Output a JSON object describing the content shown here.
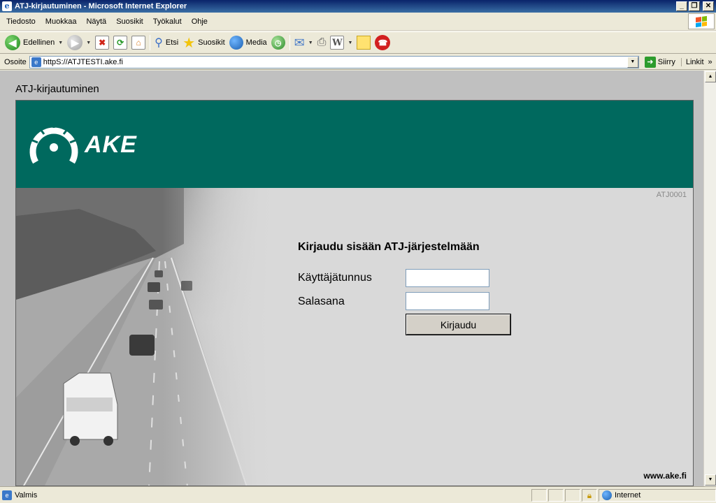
{
  "window": {
    "title": "ATJ-kirjautuminen - Microsoft Internet Explorer",
    "minimize": "_",
    "restore": "❐",
    "close": "✕"
  },
  "menu": {
    "items": [
      {
        "label": "Tiedosto"
      },
      {
        "label": "Muokkaa"
      },
      {
        "label": "Näytä"
      },
      {
        "label": "Suosikit"
      },
      {
        "label": "Työkalut"
      },
      {
        "label": "Ohje"
      }
    ]
  },
  "toolbar": {
    "back_label": "Edellinen",
    "search_label": "Etsi",
    "favorites_label": "Suosikit",
    "media_label": "Media"
  },
  "address": {
    "label": "Osoite",
    "url": "httpS://ATJTESTI.ake.fi",
    "go_label": "Siirry",
    "links_label": "Linkit",
    "links_chevron": "»"
  },
  "page": {
    "heading": "ATJ-kirjautuminen",
    "logo_text": "AKE",
    "screen_code": "ATJ0001",
    "login_title": "Kirjaudu sisään ATJ-järjestelmään",
    "username_label": "Käyttäjätunnus",
    "username_value": "",
    "password_label": "Salasana",
    "password_value": "",
    "login_button": "Kirjaudu",
    "website": "www.ake.fi"
  },
  "status": {
    "text": "Valmis",
    "zone": "Internet"
  },
  "colors": {
    "banner": "#00695e",
    "titlebar": "#0a246a",
    "chrome": "#ece9d8"
  },
  "icons": [
    "ie-icon",
    "back-icon",
    "forward-icon",
    "stop-icon",
    "refresh-icon",
    "home-icon",
    "search-icon",
    "favorites-icon",
    "media-icon",
    "history-icon",
    "mail-icon",
    "print-icon",
    "edit-icon",
    "note-icon",
    "messenger-icon",
    "go-icon",
    "lock-icon",
    "globe-icon"
  ]
}
